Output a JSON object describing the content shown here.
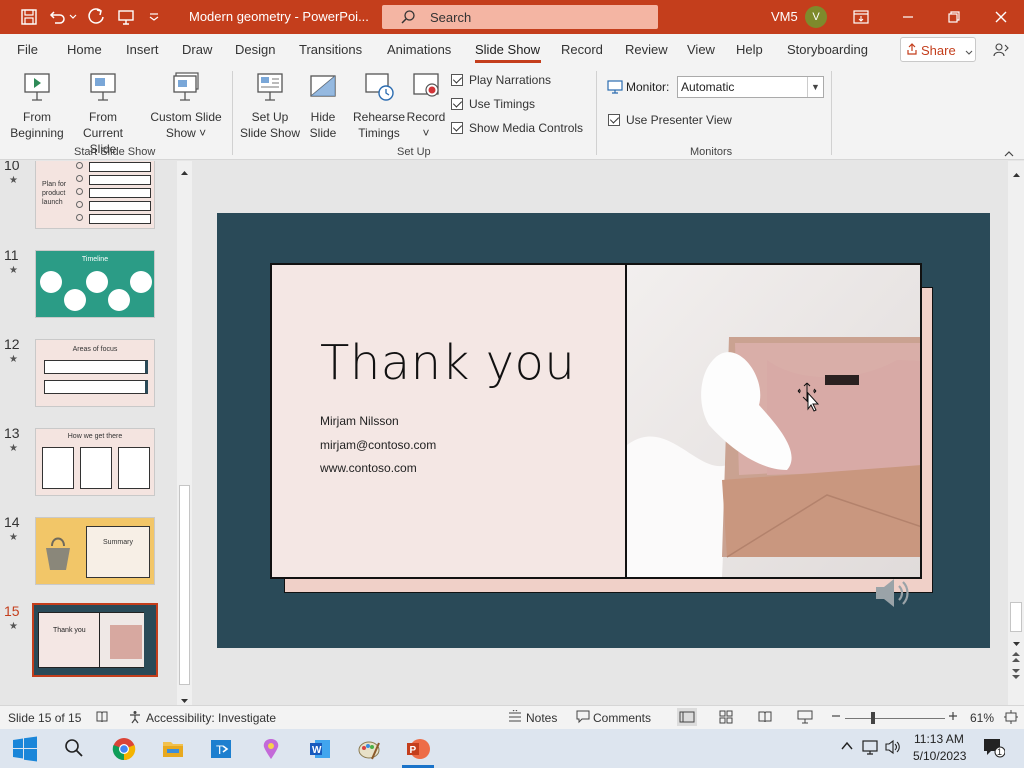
{
  "window": {
    "doc_title": "Modern geometry  -  PowerPoi...",
    "search_placeholder": "Search",
    "user_name": "VM5",
    "user_initial": "V"
  },
  "tabs": [
    "File",
    "Home",
    "Insert",
    "Draw",
    "Design",
    "Transitions",
    "Animations",
    "Slide Show",
    "Record",
    "Review",
    "View",
    "Help",
    "Storyboarding"
  ],
  "active_tab": "Slide Show",
  "share_label": "Share",
  "ribbon": {
    "start_group": {
      "label": "Start Slide Show",
      "from_beginning": [
        "From",
        "Beginning"
      ],
      "from_current": [
        "From",
        "Current Slide"
      ],
      "custom": [
        "Custom Slide",
        "Show ˅"
      ]
    },
    "setup_group": {
      "label": "Set Up",
      "setup_show": [
        "Set Up",
        "Slide Show"
      ],
      "hide_slide": [
        "Hide",
        "Slide"
      ],
      "rehearse": [
        "Rehearse",
        "Timings"
      ],
      "record": [
        "Record",
        "˅"
      ],
      "play_narrations": "Play Narrations",
      "use_timings": "Use Timings",
      "show_media_controls": "Show Media Controls"
    },
    "monitors_group": {
      "label": "Monitors",
      "monitor_label": "Monitor:",
      "monitor_value": "Automatic",
      "presenter_view": "Use Presenter View"
    }
  },
  "thumbnails": [
    {
      "num": "10",
      "title": "Plan for product launch"
    },
    {
      "num": "11",
      "title": "Timeline"
    },
    {
      "num": "12",
      "title": "Areas of focus"
    },
    {
      "num": "13",
      "title": "How we get there"
    },
    {
      "num": "14",
      "title": "Summary"
    },
    {
      "num": "15",
      "title": "Thank you"
    }
  ],
  "slide": {
    "title": "Thank you",
    "name": "Mirjam Nilsson",
    "email": "mirjam@contoso.com",
    "website": "www.contoso.com"
  },
  "status": {
    "slide_indicator": "Slide 15 of 15",
    "accessibility": "Accessibility: Investigate",
    "notes": "Notes",
    "comments": "Comments",
    "zoom": "61%"
  },
  "taskbar": {
    "time": "11:13 AM",
    "date": "5/10/2023",
    "notification_count": "1"
  },
  "colors": {
    "accent": "#c43e1c",
    "slide_bg": "#2a4a58",
    "slide_panel": "#f4e7e4"
  }
}
